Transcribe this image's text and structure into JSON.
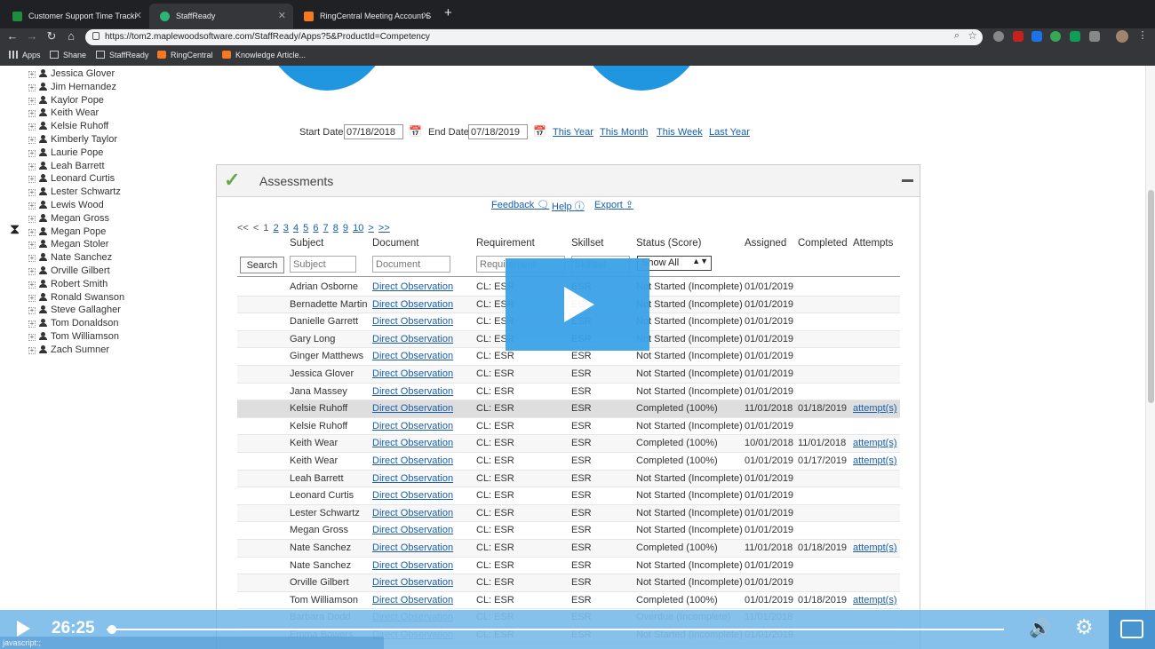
{
  "browser": {
    "tabs": [
      {
        "title": "Customer Support Time Tracki",
        "active": false,
        "favicon_color": "#1e8e3e"
      },
      {
        "title": "StaffReady",
        "active": true,
        "favicon_color": "#2bb673"
      },
      {
        "title": "RingCentral Meeting Account S",
        "active": false,
        "favicon_color": "#f47920"
      }
    ],
    "url": "https://tom2.maplewoodsoftware.com/StaffReady/Apps?5&ProductId=Competency",
    "bookmarks": [
      "Apps",
      "Shane",
      "StaffReady",
      "RingCentral",
      "Knowledge Article..."
    ]
  },
  "sidebar": {
    "people": [
      "Jessica Glover",
      "Jim Hernandez",
      "Kaylor Pope",
      "Keith Wear",
      "Kelsie Ruhoff",
      "Kimberly Taylor",
      "Laurie Pope",
      "Leah Barrett",
      "Leonard Curtis",
      "Lester Schwartz",
      "Lewis Wood",
      "Megan Gross",
      "Megan Pope",
      "Megan Stoler",
      "Nate Sanchez",
      "Orville Gilbert",
      "Robert Smith",
      "Ronald Swanson",
      "Steve Gallagher",
      "Tom Donaldson",
      "Tom Williamson",
      "Zach Sumner"
    ]
  },
  "dates": {
    "start_label": "Start Date",
    "start_value": "07/18/2018",
    "end_label": "End Date",
    "end_value": "07/18/2019",
    "quick_links": [
      "This Year",
      "This Month",
      "This Week",
      "Last Year"
    ]
  },
  "panel": {
    "title": "Assessments",
    "links": {
      "feedback": "Feedback",
      "help": "Help",
      "export": "Export"
    },
    "pager": {
      "first": "<<",
      "prev": "<",
      "pages": [
        "1",
        "2",
        "3",
        "4",
        "5",
        "6",
        "7",
        "8",
        "9",
        "10"
      ],
      "next": ">",
      "last": ">>"
    },
    "columns": [
      "Subject",
      "Document",
      "Requirement",
      "Skillset",
      "Status (Score)",
      "Assigned",
      "Completed",
      "Attempts"
    ],
    "filters": {
      "search_button": "Search",
      "subject_placeholder": "Subject",
      "document_placeholder": "Document",
      "requirement_placeholder": "Requirement",
      "skillset_placeholder": "Skillset",
      "status_selected": "Show All"
    },
    "rows": [
      {
        "subject": "Adrian Osborne",
        "document": "Direct Observation",
        "requirement": "CL: ESR",
        "skillset": "ESR",
        "status": "Not Started (Incomplete)",
        "assigned": "01/01/2019",
        "completed": "",
        "attempts": ""
      },
      {
        "subject": "Bernadette Martin",
        "document": "Direct Observation",
        "requirement": "CL: ESR",
        "skillset": "ESR",
        "status": "Not Started (Incomplete)",
        "assigned": "01/01/2019",
        "completed": "",
        "attempts": ""
      },
      {
        "subject": "Danielle Garrett",
        "document": "Direct Observation",
        "requirement": "CL: ESR",
        "skillset": "ESR",
        "status": "Not Started (Incomplete)",
        "assigned": "01/01/2019",
        "completed": "",
        "attempts": ""
      },
      {
        "subject": "Gary Long",
        "document": "Direct Observation",
        "requirement": "CL: ESR",
        "skillset": "ESR",
        "status": "Not Started (Incomplete)",
        "assigned": "01/01/2019",
        "completed": "",
        "attempts": ""
      },
      {
        "subject": "Ginger Matthews",
        "document": "Direct Observation",
        "requirement": "CL: ESR",
        "skillset": "ESR",
        "status": "Not Started (Incomplete)",
        "assigned": "01/01/2019",
        "completed": "",
        "attempts": ""
      },
      {
        "subject": "Jessica Glover",
        "document": "Direct Observation",
        "requirement": "CL: ESR",
        "skillset": "ESR",
        "status": "Not Started (Incomplete)",
        "assigned": "01/01/2019",
        "completed": "",
        "attempts": ""
      },
      {
        "subject": "Jana Massey",
        "document": "Direct Observation",
        "requirement": "CL: ESR",
        "skillset": "ESR",
        "status": "Not Started (Incomplete)",
        "assigned": "01/01/2019",
        "completed": "",
        "attempts": ""
      },
      {
        "subject": "Kelsie Ruhoff",
        "document": "Direct Observation",
        "requirement": "CL: ESR",
        "skillset": "ESR",
        "status": "Completed (100%)",
        "assigned": "11/01/2018",
        "completed": "01/18/2019",
        "attempts": "attempt(s)"
      },
      {
        "subject": "Kelsie Ruhoff",
        "document": "Direct Observation",
        "requirement": "CL: ESR",
        "skillset": "ESR",
        "status": "Not Started (Incomplete)",
        "assigned": "01/01/2019",
        "completed": "",
        "attempts": ""
      },
      {
        "subject": "Keith Wear",
        "document": "Direct Observation",
        "requirement": "CL: ESR",
        "skillset": "ESR",
        "status": "Completed (100%)",
        "assigned": "10/01/2018",
        "completed": "11/01/2018",
        "attempts": "attempt(s)"
      },
      {
        "subject": "Keith Wear",
        "document": "Direct Observation",
        "requirement": "CL: ESR",
        "skillset": "ESR",
        "status": "Completed (100%)",
        "assigned": "01/01/2019",
        "completed": "01/17/2019",
        "attempts": "attempt(s)"
      },
      {
        "subject": "Leah Barrett",
        "document": "Direct Observation",
        "requirement": "CL: ESR",
        "skillset": "ESR",
        "status": "Not Started (Incomplete)",
        "assigned": "01/01/2019",
        "completed": "",
        "attempts": ""
      },
      {
        "subject": "Leonard Curtis",
        "document": "Direct Observation",
        "requirement": "CL: ESR",
        "skillset": "ESR",
        "status": "Not Started (Incomplete)",
        "assigned": "01/01/2019",
        "completed": "",
        "attempts": ""
      },
      {
        "subject": "Lester Schwartz",
        "document": "Direct Observation",
        "requirement": "CL: ESR",
        "skillset": "ESR",
        "status": "Not Started (Incomplete)",
        "assigned": "01/01/2019",
        "completed": "",
        "attempts": ""
      },
      {
        "subject": "Megan Gross",
        "document": "Direct Observation",
        "requirement": "CL: ESR",
        "skillset": "ESR",
        "status": "Not Started (Incomplete)",
        "assigned": "01/01/2019",
        "completed": "",
        "attempts": ""
      },
      {
        "subject": "Nate Sanchez",
        "document": "Direct Observation",
        "requirement": "CL: ESR",
        "skillset": "ESR",
        "status": "Completed (100%)",
        "assigned": "11/01/2018",
        "completed": "01/18/2019",
        "attempts": "attempt(s)"
      },
      {
        "subject": "Nate Sanchez",
        "document": "Direct Observation",
        "requirement": "CL: ESR",
        "skillset": "ESR",
        "status": "Not Started (Incomplete)",
        "assigned": "01/01/2019",
        "completed": "",
        "attempts": ""
      },
      {
        "subject": "Orville Gilbert",
        "document": "Direct Observation",
        "requirement": "CL: ESR",
        "skillset": "ESR",
        "status": "Not Started (Incomplete)",
        "assigned": "01/01/2019",
        "completed": "",
        "attempts": ""
      },
      {
        "subject": "Tom Williamson",
        "document": "Direct Observation",
        "requirement": "CL: ESR",
        "skillset": "ESR",
        "status": "Completed (100%)",
        "assigned": "01/01/2019",
        "completed": "01/18/2019",
        "attempts": "attempt(s)"
      },
      {
        "subject": "Barbara Dodd",
        "document": "Direct Observation",
        "requirement": "CL: ESR",
        "skillset": "ESR",
        "status": "Overdue (Incomplete)",
        "assigned": "11/01/2018",
        "completed": "",
        "attempts": ""
      },
      {
        "subject": "Emma Bowers",
        "document": "Direct Observation",
        "requirement": "CL: ESR",
        "skillset": "ESR",
        "status": "Not Started (Incomplete)",
        "assigned": "01/01/2019",
        "completed": "",
        "attempts": ""
      }
    ]
  },
  "video": {
    "time": "26:25",
    "progress": 0.005,
    "status_text": "javascript:;"
  },
  "colors": {
    "link": "#1a5ea8",
    "accent": "#2196e0",
    "check": "#6aa84f"
  }
}
